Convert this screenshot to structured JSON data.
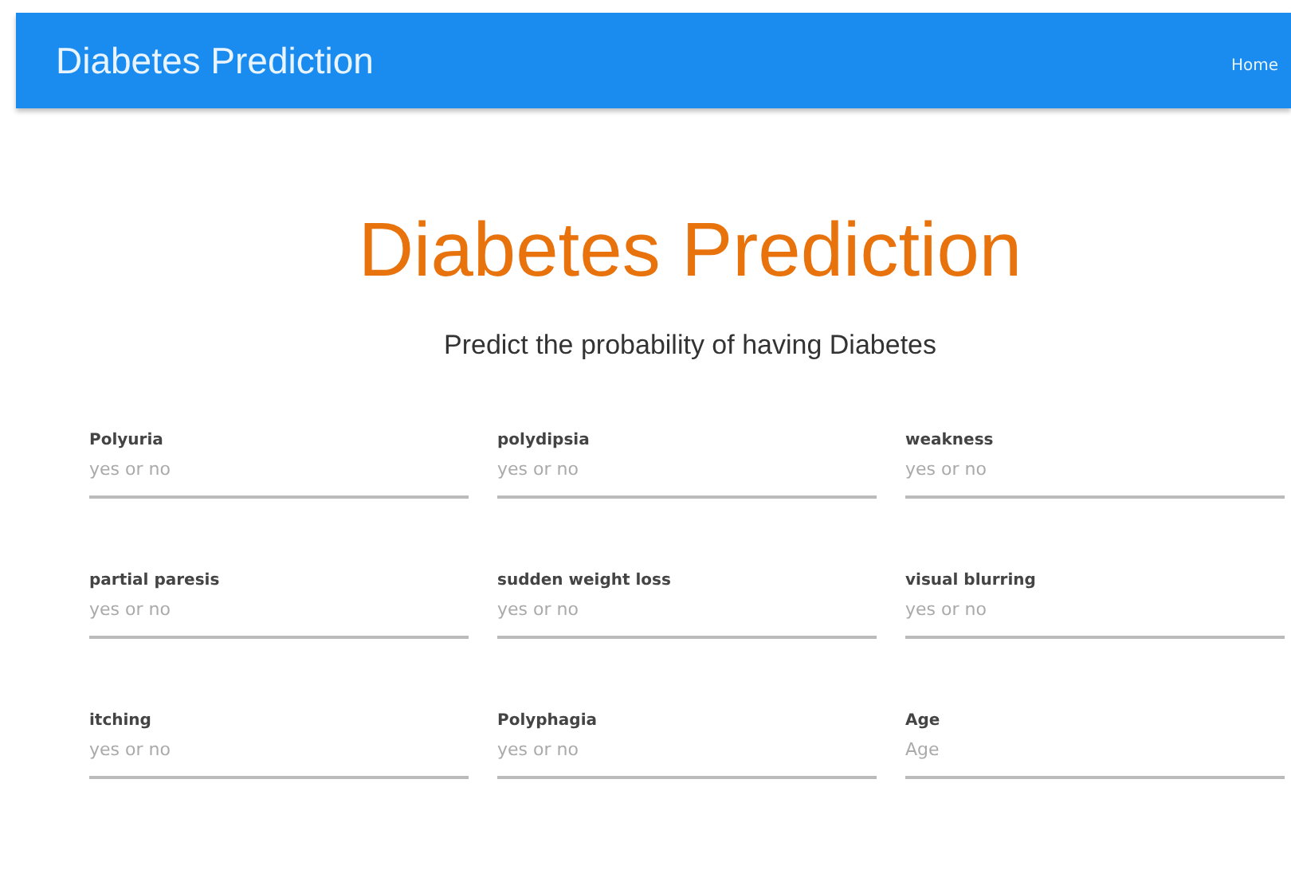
{
  "navbar": {
    "brand": "Diabetes Prediction",
    "links": [
      "Home"
    ]
  },
  "heading": "Diabetes Prediction",
  "subtitle": "Predict the probability of having Diabetes",
  "fields": [
    {
      "label": "Polyuria",
      "placeholder": "yes or no"
    },
    {
      "label": "polydipsia",
      "placeholder": "yes or no"
    },
    {
      "label": "weakness",
      "placeholder": "yes or no"
    },
    {
      "label": "partial paresis",
      "placeholder": "yes or no"
    },
    {
      "label": "sudden weight loss",
      "placeholder": "yes or no"
    },
    {
      "label": "visual blurring",
      "placeholder": "yes or no"
    },
    {
      "label": "itching",
      "placeholder": "yes or no"
    },
    {
      "label": "Polyphagia",
      "placeholder": "yes or no"
    },
    {
      "label": "Age",
      "placeholder": "Age"
    }
  ]
}
